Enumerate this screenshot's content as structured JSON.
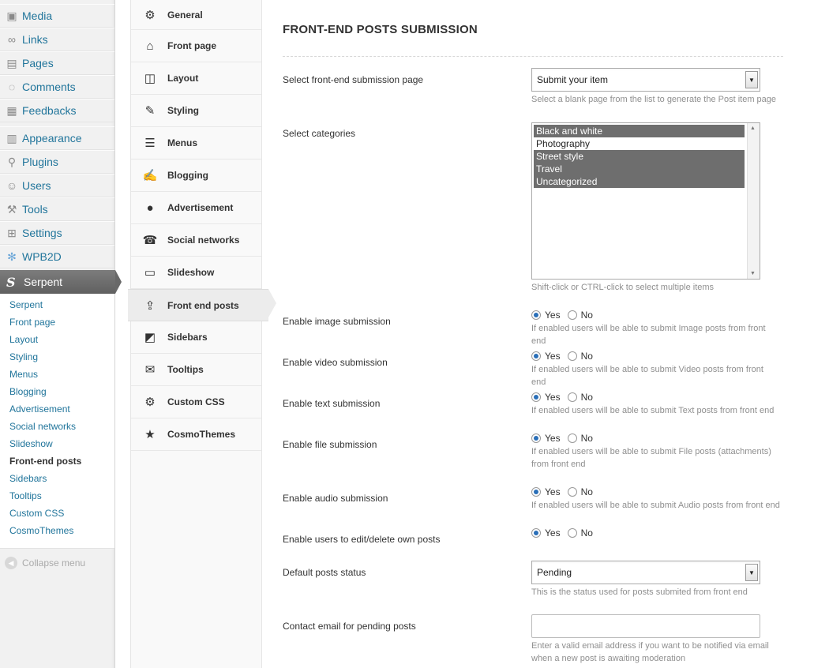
{
  "wp_menu": {
    "items": [
      {
        "label": "Media",
        "icon": "media-icon"
      },
      {
        "label": "Links",
        "icon": "links-icon"
      },
      {
        "label": "Pages",
        "icon": "pages-icon"
      },
      {
        "label": "Comments",
        "icon": "comments-icon"
      },
      {
        "label": "Feedbacks",
        "icon": "feedbacks-icon"
      },
      {
        "label": "Appearance",
        "icon": "appearance-icon"
      },
      {
        "label": "Plugins",
        "icon": "plugins-icon"
      },
      {
        "label": "Users",
        "icon": "users-icon"
      },
      {
        "label": "Tools",
        "icon": "tools-icon"
      },
      {
        "label": "Settings",
        "icon": "settings-icon"
      },
      {
        "label": "WPB2D",
        "icon": "wpb2d-icon"
      }
    ],
    "active": {
      "label": "Serpent",
      "icon": "serpent-icon"
    },
    "submenu": [
      "Serpent",
      "Front page",
      "Layout",
      "Styling",
      "Menus",
      "Blogging",
      "Advertisement",
      "Social networks",
      "Slideshow",
      "Front-end posts",
      "Sidebars",
      "Tooltips",
      "Custom CSS",
      "CosmoThemes"
    ],
    "submenu_current": "Front-end posts",
    "collapse_label": "Collapse menu"
  },
  "theme_nav": {
    "items": [
      {
        "label": "General",
        "icon": "gear-icon"
      },
      {
        "label": "Front page",
        "icon": "home-icon"
      },
      {
        "label": "Layout",
        "icon": "layout-icon"
      },
      {
        "label": "Styling",
        "icon": "brush-icon"
      },
      {
        "label": "Menus",
        "icon": "menu-list-icon"
      },
      {
        "label": "Blogging",
        "icon": "edit-icon"
      },
      {
        "label": "Advertisement",
        "icon": "piggy-bank-icon"
      },
      {
        "label": "Social networks",
        "icon": "social-icon"
      },
      {
        "label": "Slideshow",
        "icon": "presentation-icon"
      },
      {
        "label": "Front end posts",
        "icon": "upload-icon"
      },
      {
        "label": "Sidebars",
        "icon": "sidebar-icon"
      },
      {
        "label": "Tooltips",
        "icon": "speech-bubble-icon"
      },
      {
        "label": "Custom CSS",
        "icon": "gear-icon"
      },
      {
        "label": "CosmoThemes",
        "icon": "star-icon"
      }
    ],
    "active_index": 9
  },
  "main": {
    "title": "FRONT-END POSTS SUBMISSION",
    "submission_page": {
      "label": "Select front-end submission page",
      "value": "Submit your item",
      "help": "Select a blank page from the list to generate the Post item page"
    },
    "categories": {
      "label": "Select categories",
      "options": [
        {
          "text": "Black and white",
          "selected": true
        },
        {
          "text": "Photography",
          "selected": false
        },
        {
          "text": "Street style",
          "selected": true
        },
        {
          "text": "Travel",
          "selected": true
        },
        {
          "text": "Uncategorized",
          "selected": true
        }
      ],
      "help": "Shift-click or CTRL-click to select multiple items"
    },
    "yes_label": "Yes",
    "no_label": "No",
    "toggles": [
      {
        "label": "Enable image submission",
        "value": "Yes",
        "help": "If enabled users will be able to submit Image posts from front end"
      },
      {
        "label": "Enable video submission",
        "value": "Yes",
        "help": "If enabled users will be able to submit Video posts from front end"
      },
      {
        "label": "Enable text submission",
        "value": "Yes",
        "help": "If enabled users will be able to submit Text posts from front end"
      },
      {
        "label": "Enable file submission",
        "value": "Yes",
        "help": "If enabled users will be able to submit File posts (attachments) from front end"
      },
      {
        "label": "Enable audio submission",
        "value": "Yes",
        "help": "If enabled users will be able to submit Audio posts from front end"
      },
      {
        "label": "Enable users to edit/delete own posts",
        "value": "Yes",
        "help": ""
      }
    ],
    "default_status": {
      "label": "Default posts status",
      "value": "Pending",
      "help": "This is the status used for posts submited from front end"
    },
    "contact_email": {
      "label": "Contact email for pending posts",
      "value": "",
      "help": "Enter a valid email address if you want to be notified via email when a new post is awaiting moderation"
    }
  }
}
